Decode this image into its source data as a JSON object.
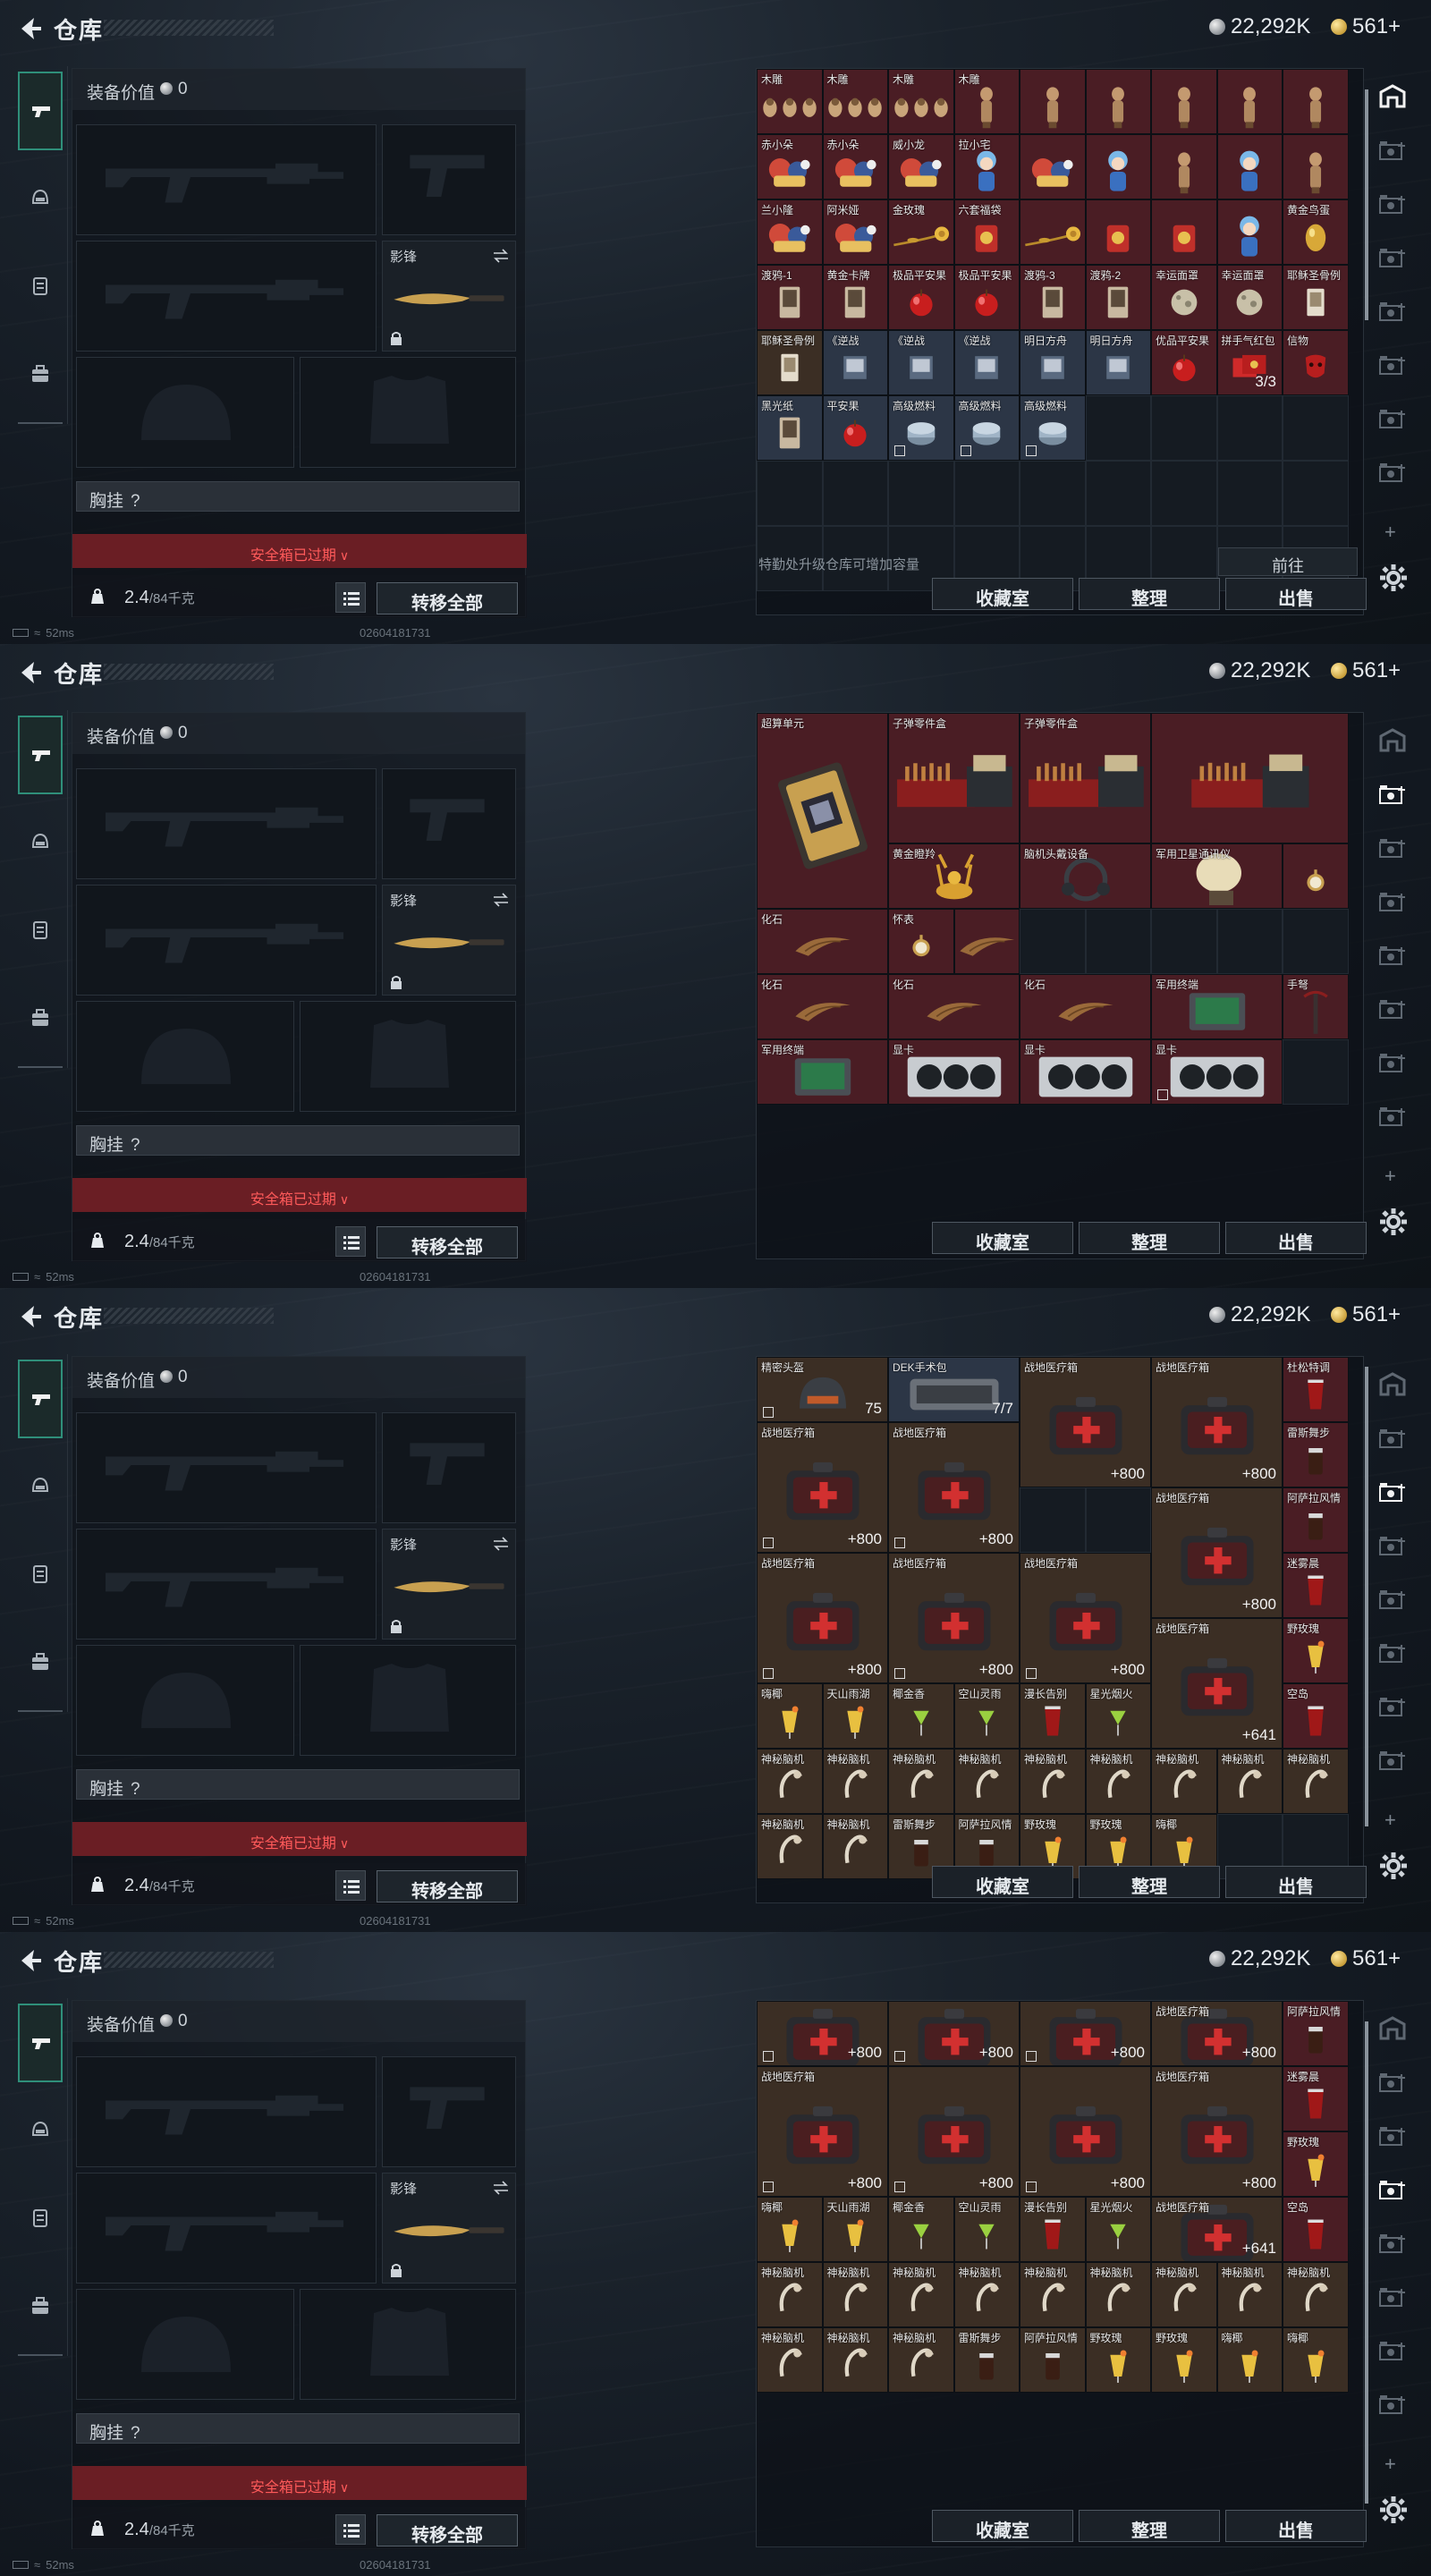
{
  "header": {
    "title": "仓库",
    "currency1": "22,292K",
    "currency2": "561+"
  },
  "equipment": {
    "value_label": "装备价值",
    "value": "0",
    "knife_label": "影锋",
    "chest_label": "胸挂",
    "chest_q": "?",
    "safe_box": "安全箱已过期",
    "weight": "2.4",
    "weight_max": "/84千克",
    "transfer_all": "转移全部"
  },
  "status": {
    "ping": "52ms",
    "id": "02604181731"
  },
  "warehouse": {
    "upgrade_hint": "特勤处升级仓库可增加容量",
    "goto": "前往",
    "btn_collection": "收藏室",
    "btn_sort": "整理",
    "btn_sell": "出售"
  },
  "screen1": {
    "items": [
      "木雕",
      "木雕",
      "木雕",
      "木雕",
      "",
      "",
      "赤小朵",
      "赤小朵",
      "威小龙",
      "拉小宅",
      "兰小隆",
      "阿米娅",
      "金玫瑰",
      "六套福袋",
      "黄金鸟蛋",
      "渡鸦-1",
      "黄金卡牌",
      "极品平安果",
      "极品平安果",
      "渡鸦-3",
      "渡鸦-2",
      "幸运面罩",
      "幸运面罩",
      "耶稣圣骨例",
      "耶稣圣骨例",
      "《逆战",
      "《逆战",
      "《逆战",
      "明日方舟",
      "明日方舟",
      "优品平安果",
      "拼手气红包",
      "信物",
      "黑光纸",
      "平安果",
      "高级燃料",
      "高级燃料",
      "高级燃料"
    ],
    "redpacket_count": "3/3"
  },
  "screen2": {
    "items": [
      "超算单元",
      "子弹零件盒",
      "子弹零件盒",
      "黄金瞪羚",
      "脑机头戴设备",
      "军用卫星通讯仪",
      "化石",
      "怀表",
      "化石",
      "化石",
      "化石",
      "军用终端",
      "手弩",
      "军用终端",
      "显卡",
      "显卡",
      "显卡"
    ]
  },
  "screen3": {
    "helmet": "精密头盔",
    "helmet_val": "75",
    "dek": "DEK手术包",
    "dek_val": "7/7",
    "medkit": "战地医疗箱",
    "medkit_val": "+800",
    "medkit_big_val": "+641",
    "drinks_a": [
      "杜松特调",
      "雷斯舞步",
      "阿萨拉风情",
      "迷雾晨",
      "野玫瑰",
      "空岛"
    ],
    "row5": [
      "嗨椰",
      "天山雨湖",
      "椰金香",
      "空山灵雨",
      "漫长告别",
      "星光烟火"
    ],
    "mystery": "神秘脑机",
    "row7": [
      "神秘脑机",
      "神秘脑机",
      "雷斯舞步",
      "阿萨拉风情",
      "野玫瑰",
      "野玫瑰",
      "嗨椰"
    ]
  },
  "screen4": {
    "row7": [
      "神秘脑机",
      "神秘脑机",
      "神秘脑机",
      "雷斯舞步",
      "阿萨拉风情",
      "野玫瑰",
      "野玫瑰",
      "嗨椰",
      "嗨椰"
    ]
  },
  "colors": {
    "accent": "#2f8f7a",
    "red_cell": "#4a1d24",
    "brown_cell": "#3b2e24",
    "safe_box": "#6a1e24"
  }
}
